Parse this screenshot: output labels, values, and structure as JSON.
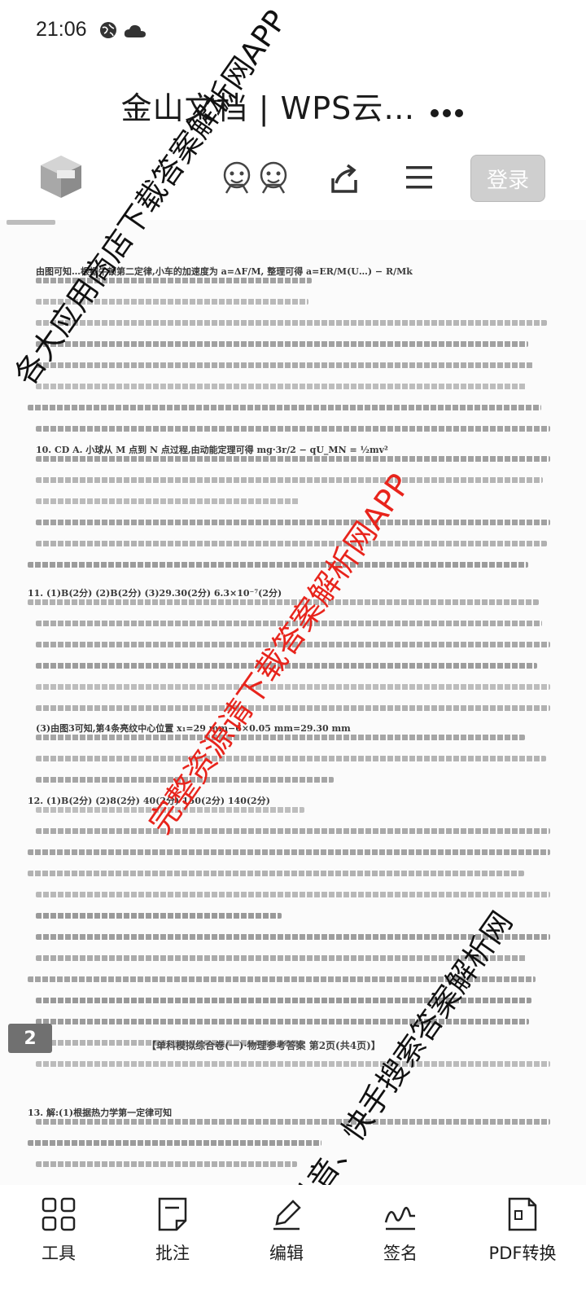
{
  "status_bar": {
    "time": "21:06",
    "icons": [
      "globe-icon",
      "cloud-icon"
    ]
  },
  "header": {
    "title": "金山文档 | WPS云…",
    "more_icon": "more-dots-icon"
  },
  "toolbar": {
    "logo_icon": "wps-cube-logo-icon",
    "avatars": [
      "avatar-emoji-icon",
      "avatar-emoji-icon"
    ],
    "share_icon": "share-icon",
    "menu_icon": "hamburger-menu-icon",
    "login_label": "登录"
  },
  "document": {
    "lines": [
      "由图可知…根据牛顿第二定律,小车的加速度为 a=ΔF/M, 整理可得 a=ER/M(U…) − R/Mk",
      "10. CD  A. 小球从 M 点到 N 点过程,由动能定理可得 mg·3r/2 − qU_MN = ½mv²",
      "11. (1)B(2分) (2)B(2分) (3)29.30(2分) 6.3×10⁻⁷(2分)",
      "(3)由图3可知,第4条亮纹中心位置 x₁=29 mm−6×0.05 mm=29.30 mm",
      "12. (1)B(2分) (2)8(2分) 40(2分) 150(2分) 140(2分)",
      "13. 解:(1)根据热力学第一定律可知"
    ],
    "page_number": "2",
    "footer_caption": "【单科模拟综合卷(一)·物理参考答案  第2页(共4页)】"
  },
  "watermarks": [
    "各大应用商店下载答案解析网APP",
    "完整资源请下载答案解析网APP",
    "微信、抖音、快手搜索答案解析网"
  ],
  "bottom_bar": {
    "items": [
      {
        "label": "工具",
        "icon": "grid-icon"
      },
      {
        "label": "批注",
        "icon": "note-icon"
      },
      {
        "label": "编辑",
        "icon": "edit-icon"
      },
      {
        "label": "签名",
        "icon": "signature-icon"
      },
      {
        "label": "PDF转换",
        "icon": "pdf-convert-icon"
      }
    ]
  }
}
